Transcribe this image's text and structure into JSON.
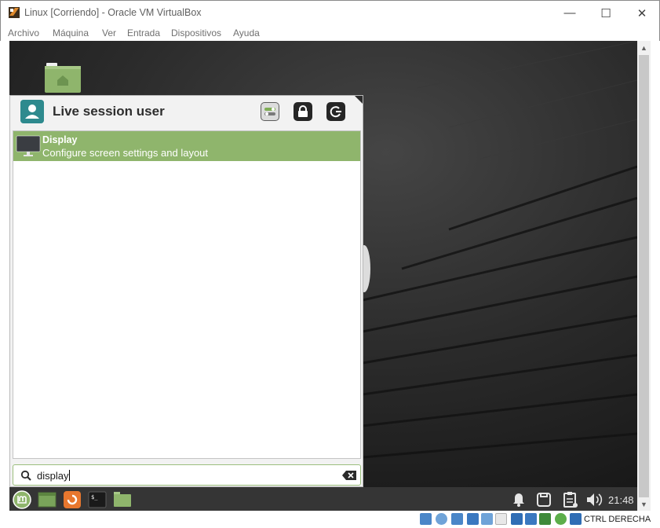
{
  "window": {
    "title": "Linux [Corriendo] - Oracle VM VirtualBox",
    "minimize_glyph": "—",
    "maximize_glyph": "☐",
    "close_glyph": "✕"
  },
  "menubar": {
    "items": [
      "Archivo",
      "Máquina",
      "Ver",
      "Entrada",
      "Dispositivos",
      "Ayuda"
    ]
  },
  "start_menu": {
    "user_name": "Live session user",
    "header_icons": [
      "settings-toggle-icon",
      "lock-icon",
      "logout-icon"
    ],
    "results": [
      {
        "title": "Display",
        "description": "Configure screen settings and layout",
        "icon": "monitor-icon"
      }
    ],
    "search": {
      "value": "display",
      "icon": "search-icon",
      "clear_icon": "backspace-icon"
    },
    "accent_color": "#8fb56c"
  },
  "taskbar": {
    "launchers": [
      "mint-menu-icon",
      "show-desktop-icon",
      "firefox-icon",
      "terminal-icon",
      "files-icon"
    ],
    "tray": [
      "notifications-icon",
      "display-icon",
      "clipboard-icon",
      "volume-icon"
    ],
    "clock": "21:48"
  },
  "statusbar": {
    "host_key": "CTRL DERECHA"
  }
}
